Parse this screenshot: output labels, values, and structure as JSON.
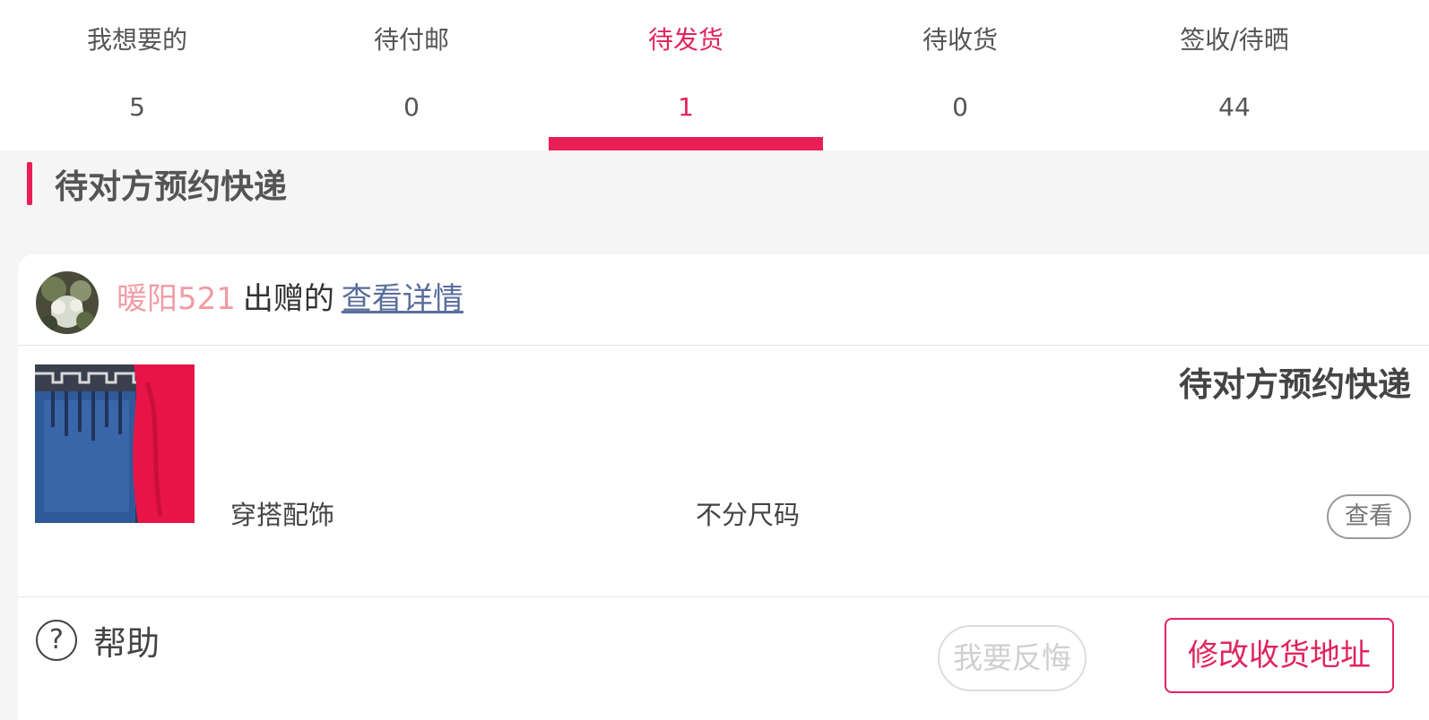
{
  "tabs": [
    {
      "label": "我想要的",
      "count": "5"
    },
    {
      "label": "待付邮",
      "count": "0"
    },
    {
      "label": "待发货",
      "count": "1"
    },
    {
      "label": "待收货",
      "count": "0"
    },
    {
      "label": "签收/待晒",
      "count": "44"
    }
  ],
  "active_tab": "待发货",
  "section": {
    "title": "待对方预约快递"
  },
  "order": {
    "seller_name": "暖阳521",
    "seller_suffix": "出赠的",
    "details_link": "查看详情",
    "status": "待对方预约快递",
    "category": "穿搭配饰",
    "size": "不分尺码",
    "view_button": "查看",
    "help_icon": "?",
    "help_label": "帮助",
    "regret_button": "我要反悔",
    "modify_address_button": "修改收货地址"
  },
  "colors": {
    "accent": "#e91e57",
    "seller_name": "#f09ca4",
    "link": "#5a6e9c"
  },
  "icons": {
    "help": "question-circle-icon"
  }
}
